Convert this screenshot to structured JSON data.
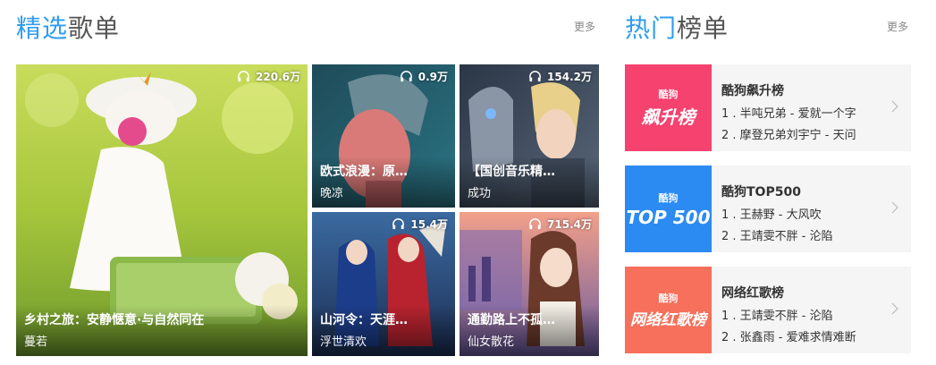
{
  "featured": {
    "title_highlight": "精选",
    "title_rest": "歌单",
    "more": "更多",
    "playlists": [
      {
        "plays": "220.6万",
        "title": "乡村之旅：安静惬意·与自然同在",
        "author": "蔓若"
      },
      {
        "plays": "0.9万",
        "title": "欧式浪漫：原…",
        "author": "晚凉"
      },
      {
        "plays": "154.2万",
        "title": "【国创音乐精…",
        "author": "成功"
      },
      {
        "plays": "15.4万",
        "title": "山河令：天涯…",
        "author": "浮世清欢"
      },
      {
        "plays": "715.4万",
        "title": "通勤路上不孤…",
        "author": "仙女散花"
      }
    ]
  },
  "charts": {
    "title_highlight": "热门",
    "title_rest": "榜单",
    "more": "更多",
    "items": [
      {
        "brand": "酷狗",
        "cover_text": "飙升榜",
        "cover_color": "#f5426f",
        "name": "酷狗飙升榜",
        "line1": "1 . 半吨兄弟 - 爱就一个字",
        "line2": "2 . 摩登兄弟刘宇宁 - 天问"
      },
      {
        "brand": "酷狗",
        "cover_text": "TOP 500",
        "cover_color": "#2c8bf2",
        "name": "酷狗TOP500",
        "line1": "1 . 王赫野 - 大风吹",
        "line2": "2 . 王靖雯不胖 - 沦陷"
      },
      {
        "brand": "酷狗",
        "cover_text": "网络红歌榜",
        "cover_color": "#f6705c",
        "name": "网络红歌榜",
        "line1": "1 . 王靖雯不胖 - 沦陷",
        "line2": "2 . 张鑫雨 - 爱难求情难断"
      }
    ]
  },
  "icons": {
    "plays": "headphones-icon",
    "arrow": "chevron-right-icon"
  }
}
